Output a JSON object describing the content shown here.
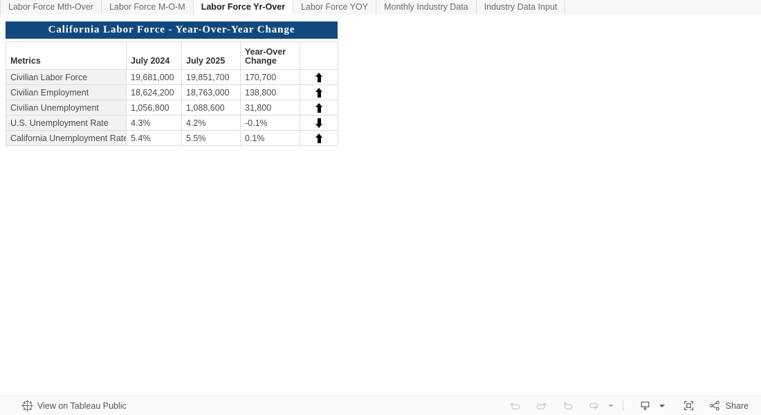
{
  "tabs": [
    {
      "label": "Labor Force Mth-Over",
      "active": false
    },
    {
      "label": "Labor Force M-O-M",
      "active": false
    },
    {
      "label": "Labor Force Yr-Over",
      "active": true
    },
    {
      "label": "Labor Force YOY",
      "active": false
    },
    {
      "label": "Monthly Industry Data",
      "active": false
    },
    {
      "label": "Industry Data Input",
      "active": false
    }
  ],
  "dashboard": {
    "title": "California  Labor  Force  -  Year-Over-Year  Change",
    "title_bg": "#11497f",
    "title_color": "#ffffff"
  },
  "table": {
    "headers": {
      "metrics": "Metrics",
      "period_1": "July 2024",
      "period_2": "July 2025",
      "change": "Year-Over Change",
      "direction": ""
    },
    "rows": [
      {
        "metric": "Civilian Labor Force",
        "july_2024": "19,681,000",
        "july_2025": "19,851,700",
        "change": "170,700",
        "direction": "up"
      },
      {
        "metric": "Civilian Employment",
        "july_2024": "18,624,200",
        "july_2025": "18,763,000",
        "change": "138,800",
        "direction": "up"
      },
      {
        "metric": "Civilian Unemployment",
        "july_2024": "1,056,800",
        "july_2025": "1,088,600",
        "change": "31,800",
        "direction": "up"
      },
      {
        "metric": "U.S. Unemployment Rate",
        "july_2024": "4.3%",
        "july_2025": "4.2%",
        "change": "-0.1%",
        "direction": "down"
      },
      {
        "metric": "California Unemployment Rate",
        "july_2024": "5.4%",
        "july_2025": "5.5%",
        "change": "0.1%",
        "direction": "up"
      }
    ]
  },
  "toolbar": {
    "view_link": "View on Tableau Public",
    "logo_icon": "tableau-logo-icon",
    "buttons": [
      {
        "name": "undo-button",
        "icon": "undo-icon",
        "enabled": false
      },
      {
        "name": "redo-button",
        "icon": "redo-icon",
        "enabled": false
      },
      {
        "name": "revert-button",
        "icon": "revert-icon",
        "enabled": false
      },
      {
        "name": "refresh-button",
        "icon": "refresh-icon",
        "enabled": false
      }
    ],
    "download_icon": "download-icon",
    "fullscreen_icon": "fullscreen-icon",
    "share_icon": "share-icon",
    "share_label": "Share"
  }
}
